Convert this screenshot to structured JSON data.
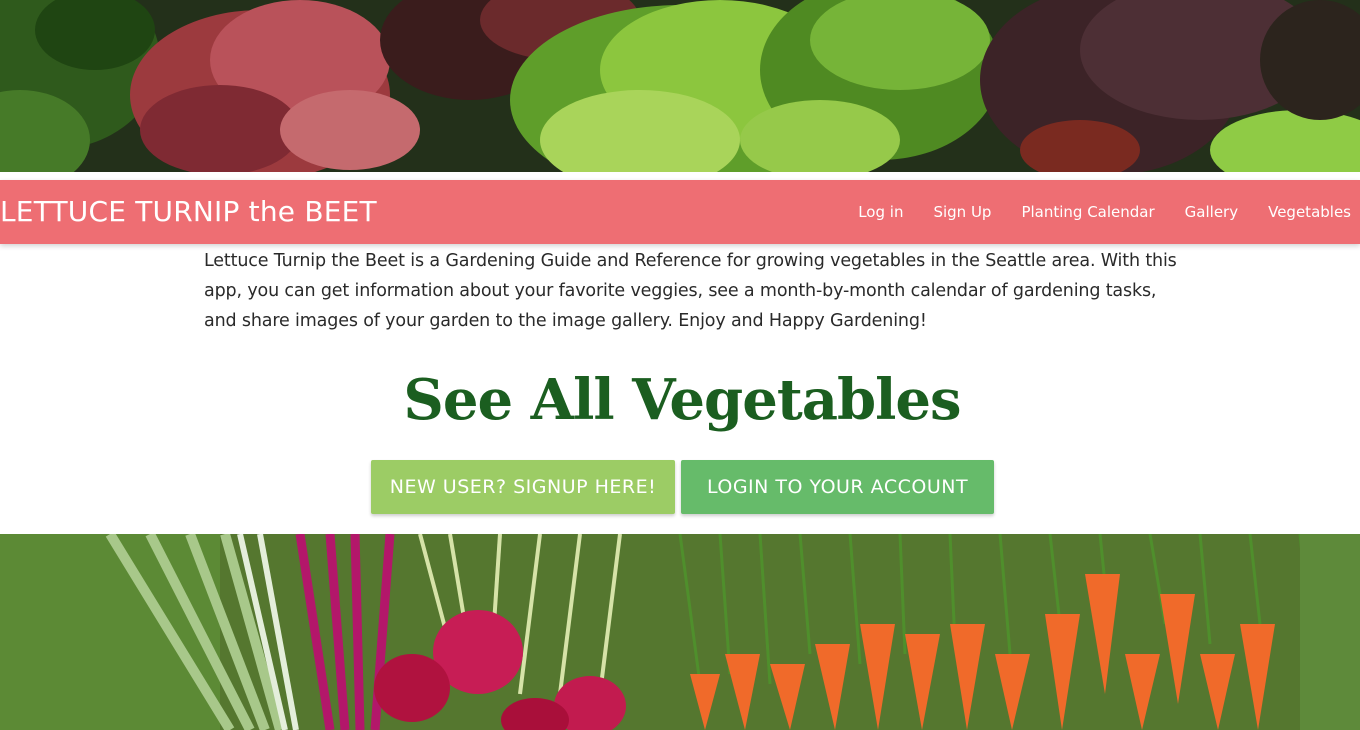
{
  "hero_top": {
    "image_name": "lettuce-garden-image"
  },
  "navbar": {
    "brand": "LETTUCE TURNIP the BEET",
    "links": [
      "Log in",
      "Sign Up",
      "Planting Calendar",
      "Gallery",
      "Vegetables"
    ]
  },
  "intro": {
    "text": "Lettuce Turnip the Beet is a Gardening Guide and Reference for growing vegetables in the Seattle area. With this app, you can get information about your favorite veggies, see a month-by-month calendar of gardening tasks, and share images of your garden to the image gallery. Enjoy and Happy Gardening!"
  },
  "main": {
    "heading": "See All Vegetables",
    "signup_button": "NEW USER? SIGNUP HERE!",
    "login_button": "LOGIN TO YOUR ACCOUNT"
  },
  "hero_bottom": {
    "image_name": "vegetables-harvest-image"
  },
  "colors": {
    "navbar": "#ee6e73",
    "heading": "#1b5e20",
    "signup_button": "#9ccc65",
    "login_button": "#66bb6a"
  }
}
